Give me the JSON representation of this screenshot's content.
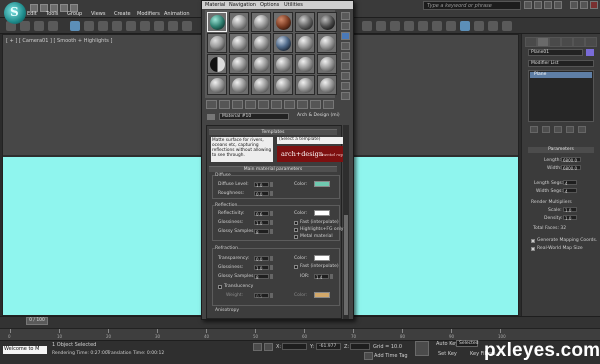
{
  "app": {
    "menus": [
      "Edit",
      "Tools",
      "Group",
      "Views",
      "Create",
      "Modifiers",
      "Animation"
    ],
    "search_placeholder": "Type a keyword or phrase"
  },
  "viewport": {
    "label": "[ + ] [ Camera01 ] [ Smooth + Highlights ]"
  },
  "material_editor": {
    "menus": [
      "Material",
      "Navigation",
      "Options",
      "Utilities"
    ],
    "material_name": "Material #10",
    "material_type": "Arch & Design (mi)",
    "templates": {
      "title": "Templates",
      "description": "Matte surface for rivers, oceans etc, capturing reflections without allowing to see through.",
      "select_label": "(Select a template)",
      "logo_text": "arch+design",
      "logo_sub": "mental ray"
    },
    "main_params": {
      "title": "Main material parameters",
      "diffuse": {
        "group": "Diffuse",
        "level_label": "Diffuse Level:",
        "level": "1.0",
        "roughness_label": "Roughness:",
        "roughness": "0.0",
        "color_label": "Color:",
        "color": "#6fc9b0"
      },
      "reflection": {
        "group": "Reflection",
        "reflectivity_label": "Reflectivity:",
        "reflectivity": "0.6",
        "glossiness_label": "Glossiness:",
        "glossiness": "1.0",
        "samples_label": "Glossy Samples:",
        "samples": "8",
        "color_label": "Color:",
        "color": "#ffffff",
        "fast_interp": "Fast (interpolate)",
        "highlights_fg": "Highlights+FG only",
        "metal_material": "Metal material"
      },
      "refraction": {
        "group": "Refraction",
        "transparency_label": "Transparency:",
        "transparency": "0.0",
        "glossiness_label": "Glossiness:",
        "glossiness": "1.0",
        "samples_label": "Glossy Samples:",
        "samples": "8",
        "color_label": "Color:",
        "color": "#ffffff",
        "fast_interp": "Fast (interpolate)",
        "ior_label": "IOR:",
        "ior": "1.4"
      },
      "translucency": {
        "label": "Translucency",
        "weight_label": "Weight:",
        "weight": "0.5",
        "color_label": "Color:",
        "color": "#d2a86a"
      },
      "anisotropy": "Anisotropy"
    }
  },
  "command_panel": {
    "object_name": "Plane01",
    "object_color": "#7a6cd8",
    "modifier_list": "Modifier List",
    "stack_item": "Plane",
    "params": {
      "title": "Parameters",
      "length_label": "Length:",
      "length": "6800.0",
      "width_label": "Width:",
      "width": "6800.0",
      "length_segs_label": "Length Segs:",
      "length_segs": "4",
      "width_segs_label": "Width Segs:",
      "width_segs": "4",
      "render_mult_label": "Render Multipliers",
      "scale_label": "Scale:",
      "scale": "1.0",
      "density_label": "Density:",
      "density": "1.0",
      "total_faces": "Total Faces: 32",
      "gen_mapping": "Generate Mapping Coords.",
      "real_world": "Real-World Map Size"
    }
  },
  "timeline": {
    "slider": "0 / 100",
    "ticks": [
      "0",
      "10",
      "20",
      "30",
      "40",
      "50",
      "60",
      "70",
      "80",
      "90",
      "100"
    ]
  },
  "status": {
    "listener": "Welcome to M",
    "selected": "1 Object Selected",
    "render_time": "Rendering Time: 0:27:00",
    "translation_time": "Translation Time: 0:00:12",
    "x_label": "X:",
    "y_label": "Y:",
    "y_value": "-61.977",
    "z_label": "Z:",
    "grid": "Grid = 10.0",
    "add_time_tag": "Add Time Tag",
    "auto_key": "Auto Key",
    "set_key": "Set Key",
    "selected_dropdown": "Selected",
    "key_filters": "Key Filters..."
  },
  "watermark": "pxleyes.com"
}
